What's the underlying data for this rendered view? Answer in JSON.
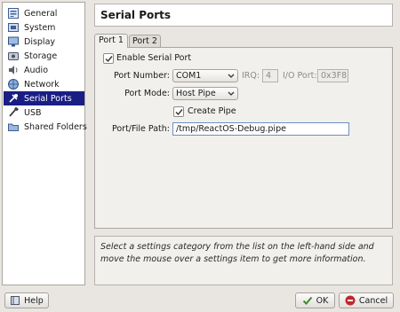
{
  "sidebar": {
    "items": [
      {
        "label": "General",
        "icon": "general-icon",
        "selected": false
      },
      {
        "label": "System",
        "icon": "system-icon",
        "selected": false
      },
      {
        "label": "Display",
        "icon": "display-icon",
        "selected": false
      },
      {
        "label": "Storage",
        "icon": "storage-icon",
        "selected": false
      },
      {
        "label": "Audio",
        "icon": "audio-icon",
        "selected": false
      },
      {
        "label": "Network",
        "icon": "network-icon",
        "selected": false
      },
      {
        "label": "Serial Ports",
        "icon": "serial-ports-icon",
        "selected": true
      },
      {
        "label": "USB",
        "icon": "usb-icon",
        "selected": false
      },
      {
        "label": "Shared Folders",
        "icon": "shared-folders-icon",
        "selected": false
      }
    ]
  },
  "page": {
    "title": "Serial Ports"
  },
  "tabs": [
    {
      "label": "Port 1",
      "active": true
    },
    {
      "label": "Port 2",
      "active": false
    }
  ],
  "port": {
    "enable_label": "Enable Serial Port",
    "enabled": true,
    "port_number_label": "Port Number:",
    "port_number_value": "COM1",
    "irq_label": "IRQ:",
    "irq_value": "4",
    "io_port_label": "I/O Port:",
    "io_port_value": "0x3F8",
    "port_mode_label": "Port Mode:",
    "port_mode_value": "Host Pipe",
    "create_pipe_label": "Create Pipe",
    "create_pipe_checked": true,
    "path_label": "Port/File Path:",
    "path_value": "/tmp/ReactOS-Debug.pipe"
  },
  "info_text": "Select a settings category from the list on the left-hand side and move the mouse over a settings item to get more information.",
  "buttons": {
    "help": "Help",
    "ok": "OK",
    "cancel": "Cancel"
  },
  "colors": {
    "selection": "#1a1e84",
    "accent_input_border": "#6d8fc4",
    "cancel_icon": "#c0282d",
    "ok_check": "#3f8a2e"
  }
}
